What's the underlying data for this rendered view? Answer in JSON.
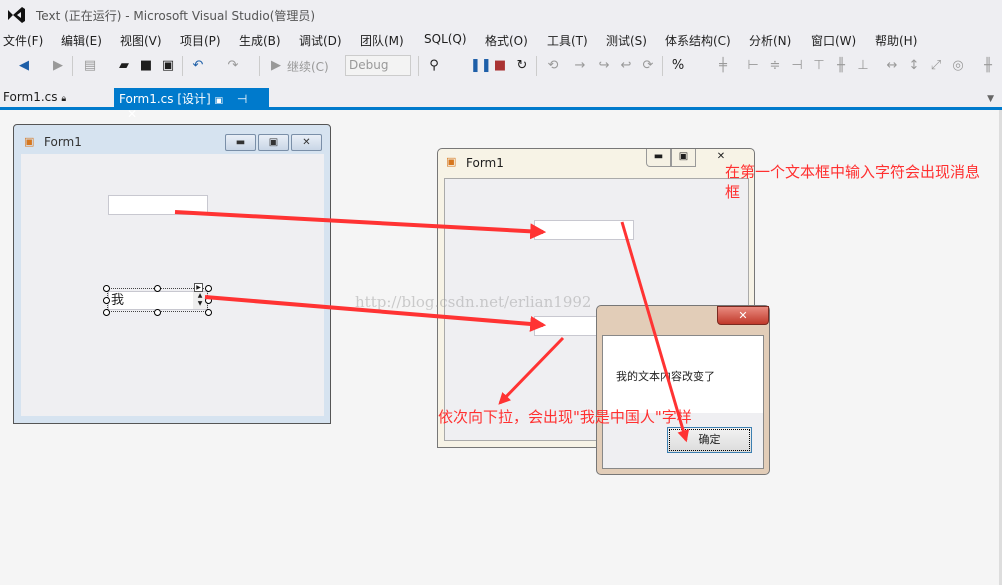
{
  "window": {
    "title": "Text (正在运行) - Microsoft Visual Studio(管理员)"
  },
  "menu": [
    "文件(F)",
    "编辑(E)",
    "视图(V)",
    "项目(P)",
    "生成(B)",
    "调试(D)",
    "团队(M)",
    "SQL(Q)",
    "格式(O)",
    "工具(T)",
    "测试(S)",
    "体系结构(C)",
    "分析(N)",
    "窗口(W)",
    "帮助(H)"
  ],
  "toolbar": {
    "continue_label": "继续(C)",
    "config_value": "Debug"
  },
  "tabs": [
    {
      "label": "Form1.cs"
    },
    {
      "label": "Form1.cs [设计]"
    }
  ],
  "designer": {
    "form_title": "Form1",
    "numeric_value": "我"
  },
  "runtime": {
    "form_title": "Form1"
  },
  "dialog": {
    "message": "我的文本内容改变了",
    "ok_label": "确定"
  },
  "annotations": {
    "note1_line1": "在第一个文本框中输入字符会出现消息",
    "note1_line2": "框",
    "note2": "依次向下拉，会出现\"我是中国人\"字样",
    "watermark": "http://blog.csdn.net/erlian1992"
  },
  "colors": {
    "accent": "#007acc",
    "annotation": "#ff3030"
  }
}
